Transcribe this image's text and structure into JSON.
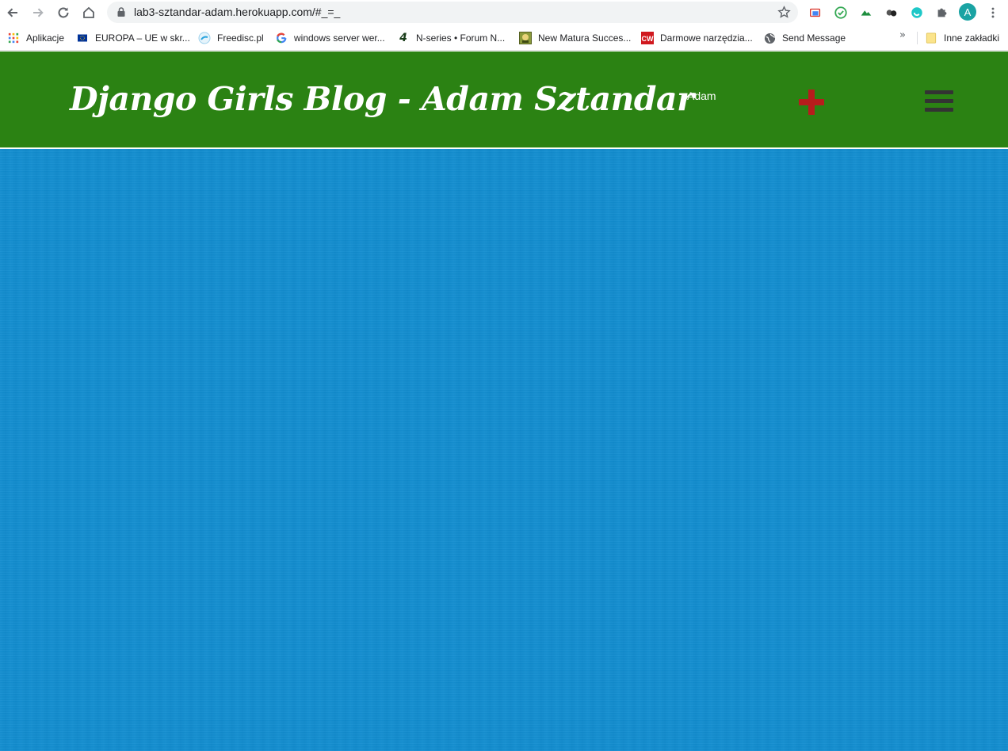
{
  "browser": {
    "url": "lab3-sztandar-adam.herokuapp.com/#_=_",
    "profile_initial": "A",
    "bookmarks": [
      {
        "label": "Aplikacje",
        "icon": "apps-grid-icon"
      },
      {
        "label": "EUROPA – UE w skr...",
        "icon": "eu-flag-icon"
      },
      {
        "label": "Freedisc.pl",
        "icon": "freedisc-icon"
      },
      {
        "label": "windows server wer...",
        "icon": "google-icon"
      },
      {
        "label": "N-series • Forum N...",
        "icon": "n-series-icon"
      },
      {
        "label": "New Matura Succes...",
        "icon": "matura-icon"
      },
      {
        "label": "Darmowe narzędzia...",
        "icon": "cw-icon"
      },
      {
        "label": "Send Message",
        "icon": "globe-icon"
      }
    ],
    "overflow_label": "»",
    "other_bookmarks": "Inne zakładki"
  },
  "header": {
    "title": "Django Girls Blog - Adam Sztandar",
    "user": "Adam",
    "add_icon": "plus-icon",
    "menu_icon": "hamburger-menu-icon"
  },
  "colors": {
    "header_bg": "#2b8213",
    "body_bg": "#118dd0",
    "plus": "#b71c1c",
    "menu": "#333333"
  }
}
